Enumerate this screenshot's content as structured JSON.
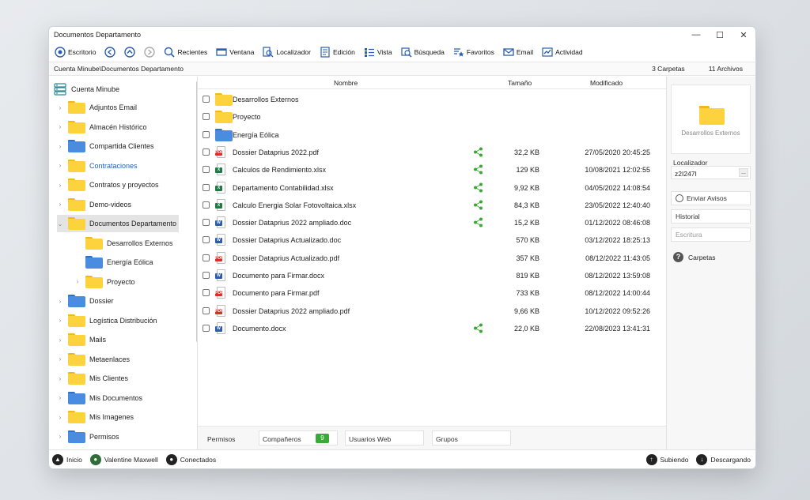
{
  "window": {
    "title": "Documentos Departamento"
  },
  "toolbar": {
    "escritorio": "Escritorio",
    "recientes": "Recientes",
    "ventana": "Ventana",
    "localizador": "Localizador",
    "edicion": "Edición",
    "vista": "Vista",
    "busqueda": "Búsqueda",
    "favoritos": "Favoritos",
    "email": "Email",
    "actividad": "Actividad"
  },
  "pathbar": {
    "path": "Cuenta Minube\\Documentos Departamento",
    "folders_count": "3 Carpetas",
    "files_count": "11 Archivos"
  },
  "sidebar": {
    "root": "Cuenta Minube",
    "items": [
      {
        "label": "Adjuntos Email",
        "color": "yellow"
      },
      {
        "label": "Almacén Histórico",
        "color": "yellow"
      },
      {
        "label": "Compartida Clientes",
        "color": "blue"
      },
      {
        "label": "Contrataciones",
        "color": "yellow"
      },
      {
        "label": "Contratos y proyectos",
        "color": "yellow"
      },
      {
        "label": "Demo-videos",
        "color": "yellow"
      },
      {
        "label": "Documentos Departamento",
        "color": "yellow"
      },
      {
        "label": "Desarrollos Externos",
        "color": "yellow"
      },
      {
        "label": "Energía Eólica",
        "color": "blue"
      },
      {
        "label": "Proyecto",
        "color": "yellow"
      },
      {
        "label": "Dossier",
        "color": "blue"
      },
      {
        "label": "Logística Distribución",
        "color": "yellow"
      },
      {
        "label": "Mails",
        "color": "yellow"
      },
      {
        "label": "Metaenlaces",
        "color": "yellow"
      },
      {
        "label": "Mis Clientes",
        "color": "yellow"
      },
      {
        "label": "Mis Documentos",
        "color": "blue"
      },
      {
        "label": "Mis Imagenes",
        "color": "yellow"
      },
      {
        "label": "Permisos",
        "color": "blue"
      }
    ]
  },
  "table": {
    "headers": {
      "name": "Nombre",
      "size": "Tamaño",
      "modified": "Modificado"
    },
    "rows": [
      {
        "name": "Desarrollos Externos",
        "type": "folder-yellow",
        "size": "",
        "date": "",
        "shared": false
      },
      {
        "name": "Proyecto",
        "type": "folder-yellow",
        "size": "",
        "date": "",
        "shared": false
      },
      {
        "name": "Energía Eólica",
        "type": "folder-blue",
        "size": "",
        "date": "",
        "shared": false
      },
      {
        "name": "Dossier Dataprius 2022.pdf",
        "type": "pdf",
        "size": "32,2 KB",
        "date": "27/05/2020 20:45:25",
        "shared": true
      },
      {
        "name": "Calculos de Rendimiento.xlsx",
        "type": "xls",
        "size": "129 KB",
        "date": "10/08/2021 12:02:55",
        "shared": true
      },
      {
        "name": "Departamento Contabilidad.xlsx",
        "type": "xls",
        "size": "9,92 KB",
        "date": "04/05/2022 14:08:54",
        "shared": true
      },
      {
        "name": "Calculo Energia Solar Fotovoltaica.xlsx",
        "type": "xls",
        "size": "84,3 KB",
        "date": "23/05/2022 12:40:40",
        "shared": true
      },
      {
        "name": "Dossier Dataprius 2022 ampliado.doc",
        "type": "doc",
        "size": "15,2 KB",
        "date": "01/12/2022 08:46:08",
        "shared": true
      },
      {
        "name": "Dossier Dataprius Actualizado.doc",
        "type": "doc",
        "size": "570 KB",
        "date": "03/12/2022 18:25:13",
        "shared": false
      },
      {
        "name": "Dossier Dataprius Actualizado.pdf",
        "type": "pdf",
        "size": "357 KB",
        "date": "08/12/2022 11:43:05",
        "shared": false
      },
      {
        "name": "Documento para Firmar.docx",
        "type": "doc",
        "size": "819 KB",
        "date": "08/12/2022 13:59:08",
        "shared": false
      },
      {
        "name": "Documento para Firmar.pdf",
        "type": "pdf",
        "size": "733 KB",
        "date": "08/12/2022 14:00:44",
        "shared": false
      },
      {
        "name": "Dossier Dataprius 2022 ampliado.pdf",
        "type": "pdf",
        "size": "9,66 KB",
        "date": "10/12/2022 09:52:26",
        "shared": false
      },
      {
        "name": "Documento.docx",
        "type": "doc",
        "size": "22,0 KB",
        "date": "22/08/2023 13:41:31",
        "shared": true
      }
    ]
  },
  "bottom_tabs": {
    "permisos": "Permisos",
    "companeros": "Compañeros",
    "companeros_count": "9",
    "usuarios_web": "Usuarios Web",
    "grupos": "Grupos"
  },
  "right_panel": {
    "preview_label": "Desarrollos Externos",
    "localizador_label": "Localizador",
    "localizador_value": "z2I247I",
    "dots": "...",
    "enviar_avisos": "Enviar Avisos",
    "historial": "Historial",
    "escritura": "Escritura",
    "carpetas": "Carpetas",
    "help_glyph": "?"
  },
  "statusbar": {
    "inicio": "Inicio",
    "user": "Valentine Maxwell",
    "conectados": "Conectados",
    "subiendo": "Subiendo",
    "descargando": "Descargando"
  },
  "colors": {
    "folder_yellow": "#fcd33c",
    "folder_blue": "#4a8ce0",
    "share_green": "#3aa935",
    "link_blue": "#2a5db0"
  }
}
